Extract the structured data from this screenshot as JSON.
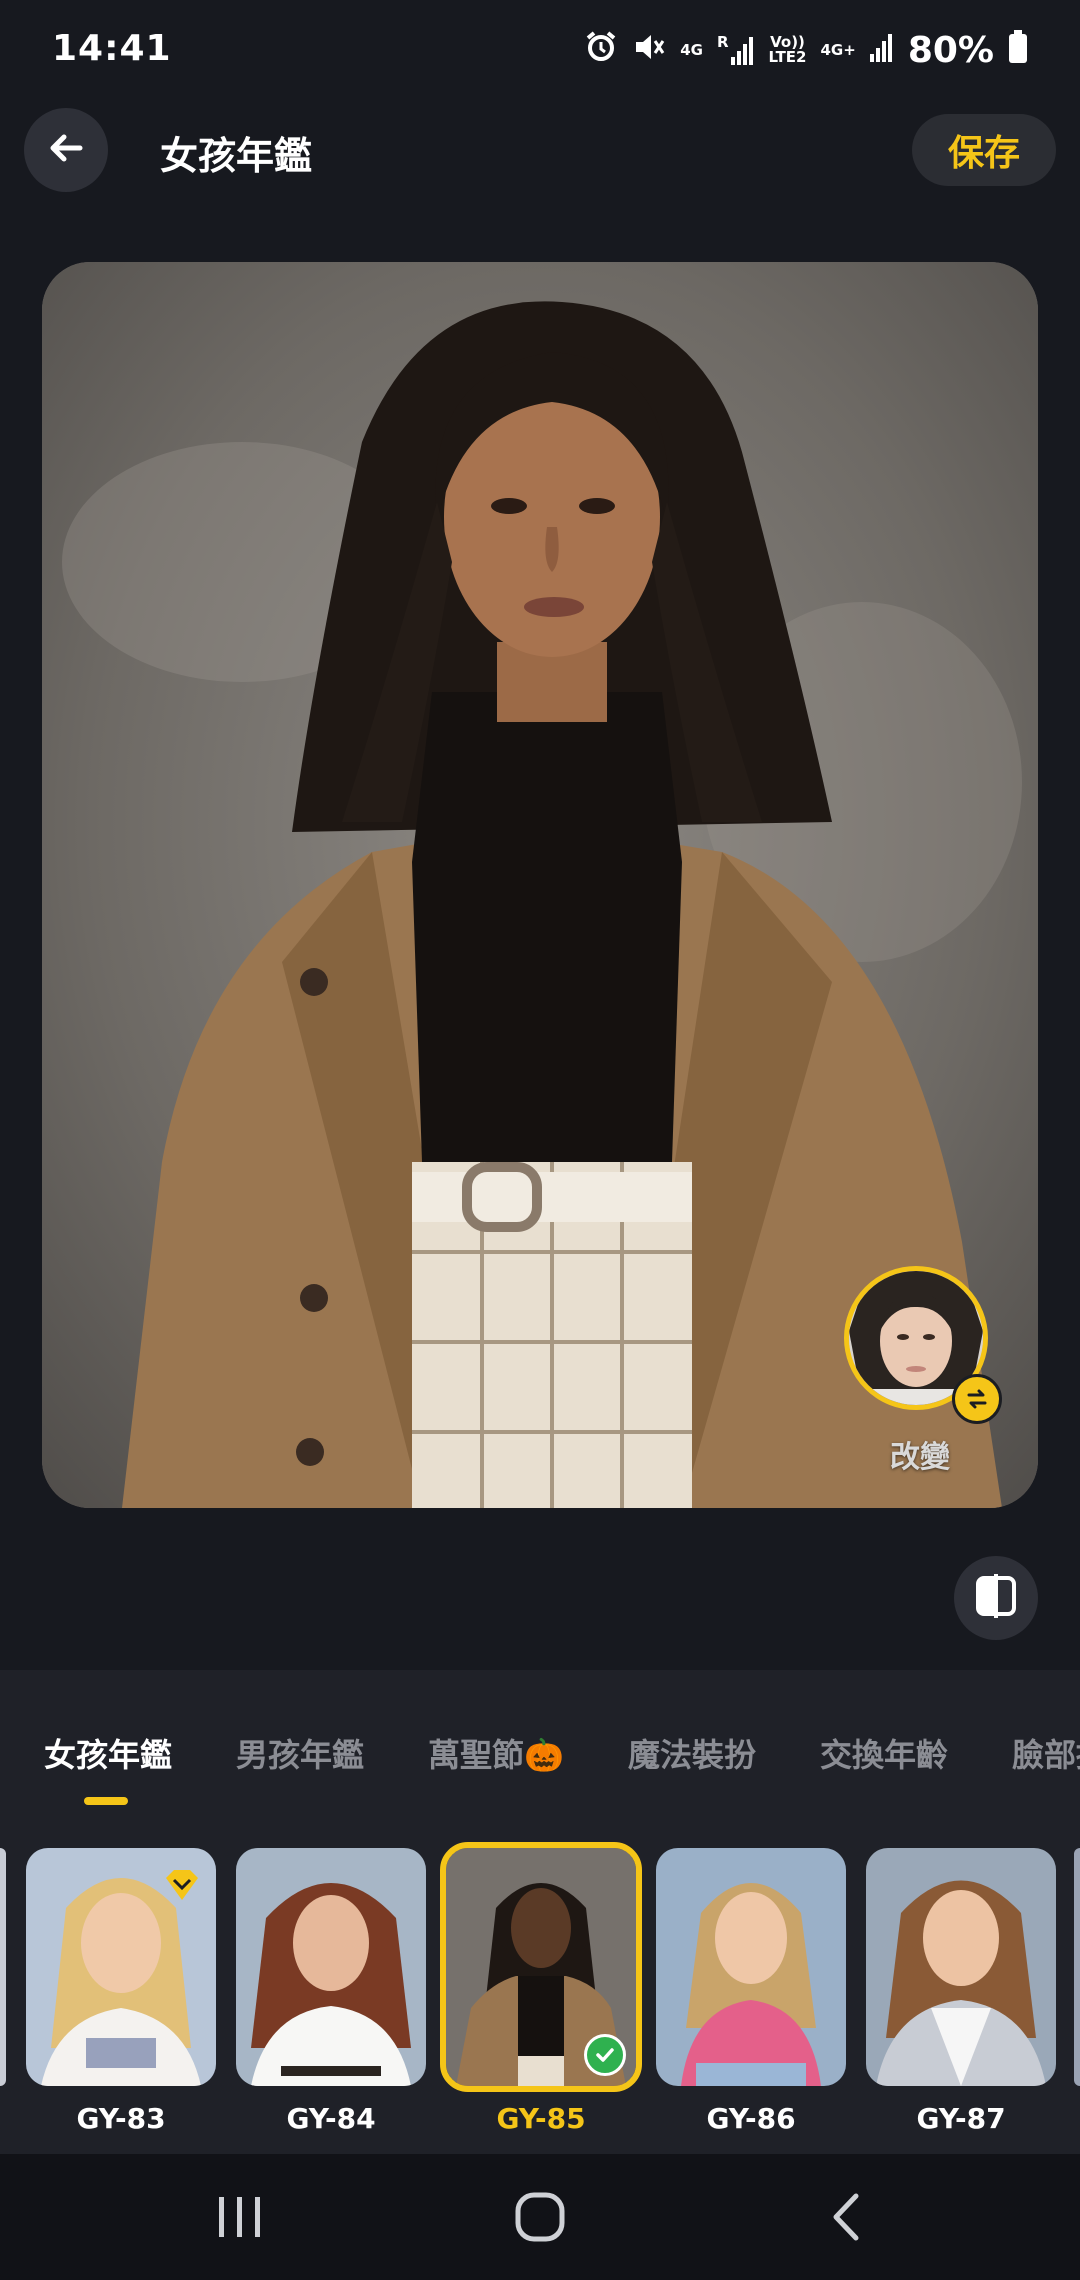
{
  "status_bar": {
    "time": "14:41",
    "network_1": "4G",
    "network_roaming": "R",
    "volte_top": "Vo))",
    "volte_bottom": "LTE2",
    "network_2": "4G+",
    "battery": "80%"
  },
  "header": {
    "title": "女孩年鑑",
    "save_label": "保存"
  },
  "editor": {
    "face_swap_label": "改變"
  },
  "tabs": [
    {
      "label": "女孩年鑑",
      "active": true
    },
    {
      "label": "男孩年鑑",
      "active": false
    },
    {
      "label": "萬聖節🎃",
      "active": false
    },
    {
      "label": "魔法裝扮",
      "active": false
    },
    {
      "label": "交換年齡",
      "active": false
    },
    {
      "label": "臉部換",
      "active": false
    }
  ],
  "styles": [
    {
      "label": "GY-83",
      "premium": true,
      "selected": false
    },
    {
      "label": "GY-84",
      "premium": false,
      "selected": false
    },
    {
      "label": "GY-85",
      "premium": false,
      "selected": true
    },
    {
      "label": "GY-86",
      "premium": false,
      "selected": false
    },
    {
      "label": "GY-87",
      "premium": false,
      "selected": false
    }
  ],
  "colors": {
    "accent": "#f5c518",
    "background": "#17191f",
    "panel": "#1f2128",
    "check": "#2fb14f"
  },
  "icons": {
    "back": "arrow-left-icon",
    "compare": "compare-split-icon",
    "swap": "swap-arrows-icon",
    "premium": "diamond-crown-icon",
    "nav_recent": "recent-apps-icon",
    "nav_home": "home-icon",
    "nav_back": "chevron-left-icon"
  }
}
